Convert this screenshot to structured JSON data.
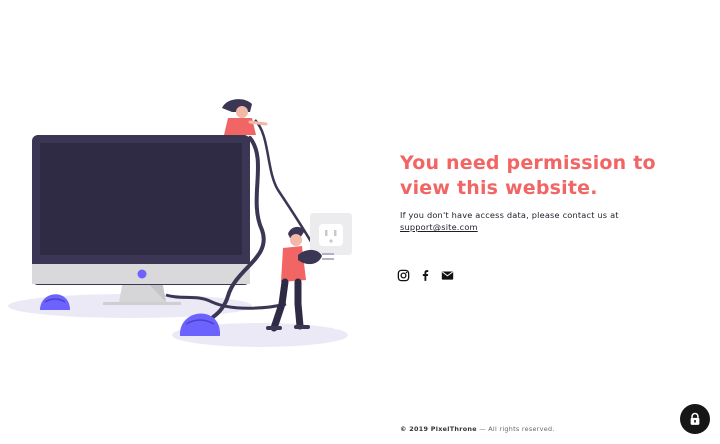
{
  "content": {
    "headline_line1": "You need permission to",
    "headline_line2": "view this website.",
    "message_text": "If you don't have access data, please contact us at",
    "support_email": "support@site.com"
  },
  "social_links": [
    {
      "icon": "instagram-icon"
    },
    {
      "icon": "facebook-icon"
    },
    {
      "icon": "mail-icon"
    }
  ],
  "footer": {
    "brand_prefix": "© 2019 PixelThrone",
    "suffix": " — All rights reserved."
  },
  "lock_button": {
    "icon": "lock-icon"
  },
  "colors": {
    "accent": "#f26565",
    "text": "#1e1e2a",
    "illustration_dark": "#3a3654",
    "illustration_purple": "#6c63ff",
    "lock_background": "#161616"
  }
}
